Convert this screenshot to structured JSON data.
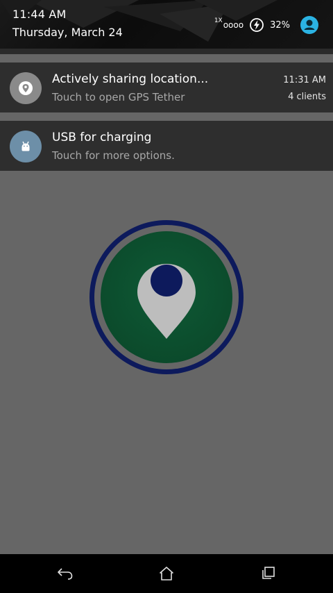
{
  "status": {
    "time": "11:44 AM",
    "date": "Thursday, March 24",
    "network_prefix": "1X",
    "signal": "oooo",
    "battery": "32%"
  },
  "notifications": [
    {
      "title": "Actively sharing location...",
      "subtitle": "Touch to open GPS Tether",
      "time": "11:31 AM",
      "meta": "4 clients",
      "icon": "location-pin-icon",
      "icon_bg": "#8a8a8a"
    },
    {
      "title": "USB for charging",
      "subtitle": "Touch for more options.",
      "icon": "android-icon",
      "icon_bg": "#6d8fa8"
    }
  ],
  "app": {
    "logo_icon": "gps-tether-logo",
    "colors": {
      "ring": "#0d1a5c",
      "fill": "#0f5a36",
      "pin": "#bdbdbd"
    }
  },
  "navbar": {
    "back_icon": "back-icon",
    "home_icon": "home-icon",
    "recents_icon": "recents-icon"
  }
}
